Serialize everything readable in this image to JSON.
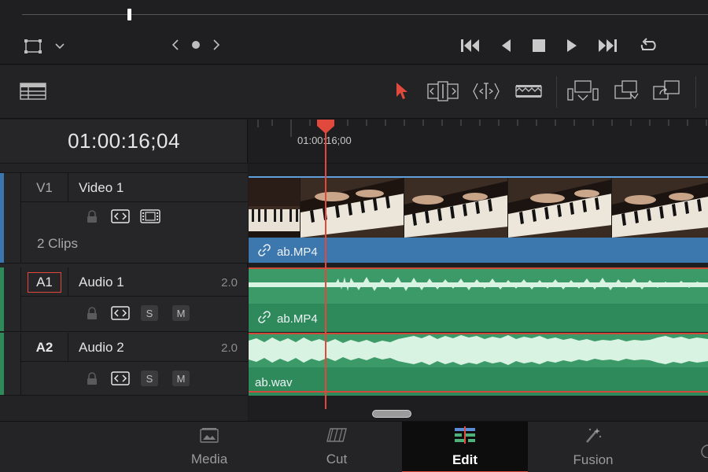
{
  "timecode": "01:00:16;04",
  "ruler": {
    "label": "01:00:16;00"
  },
  "tracks": [
    {
      "id": "V1",
      "name": "Video 1",
      "info": "2 Clips",
      "color": "#3a75ad"
    },
    {
      "id": "A1",
      "name": "Audio 1",
      "channels": "2.0",
      "color": "#2e8a5a",
      "solo": "S",
      "mute": "M"
    },
    {
      "id": "A2",
      "name": "Audio 2",
      "channels": "2.0",
      "color": "#2e8a5a",
      "solo": "S",
      "mute": "M"
    }
  ],
  "clips": {
    "video": "ab.MP4",
    "audio1": "ab.MP4",
    "audio2": "ab.wav"
  },
  "pages": [
    {
      "label": "Media",
      "icon": "media-icon"
    },
    {
      "label": "Cut",
      "icon": "cut-icon"
    },
    {
      "label": "Edit",
      "icon": "edit-icon",
      "active": true
    },
    {
      "label": "Fusion",
      "icon": "fusion-icon"
    }
  ],
  "colors": {
    "playhead": "#e0493b",
    "video_clip": "#3c78ad",
    "audio_clip": "#2e8a5a",
    "selection_tool": "#e0493b"
  }
}
